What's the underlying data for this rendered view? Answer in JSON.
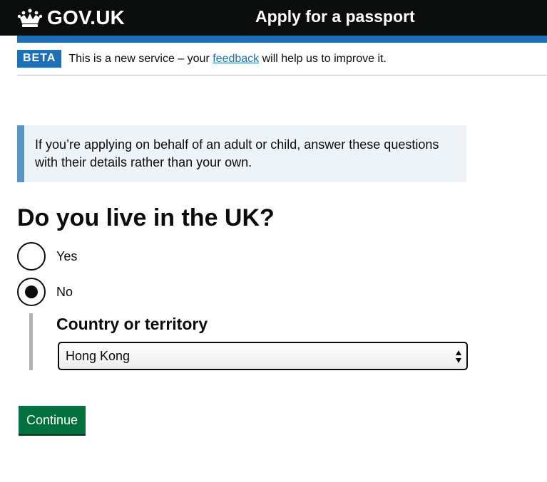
{
  "header": {
    "logo_text": "GOV.UK",
    "service_name": "Apply for a passport",
    "logo_icon": "crown-icon",
    "colors": {
      "background": "#0b0c0c",
      "accent_bar": "#1d70b8"
    }
  },
  "phase_banner": {
    "tag": "BETA",
    "text_before": "This is a new service – your ",
    "link": "feedback",
    "text_after": " will help us to improve it."
  },
  "inset_text": "If you’re applying on behalf of an adult or child, answer these questions with their details rather than your own.",
  "question": {
    "heading": "Do you live in the UK?",
    "options": [
      {
        "label": "Yes",
        "selected": false
      },
      {
        "label": "No",
        "selected": true
      }
    ]
  },
  "country": {
    "label": "Country or territory",
    "selected_value": "Hong Kong"
  },
  "continue_label": "Continue",
  "colors": {
    "link": "#1d70b8",
    "button": "#00703c",
    "inset_border": "#5694ca",
    "inset_bg": "#eef3f8"
  }
}
